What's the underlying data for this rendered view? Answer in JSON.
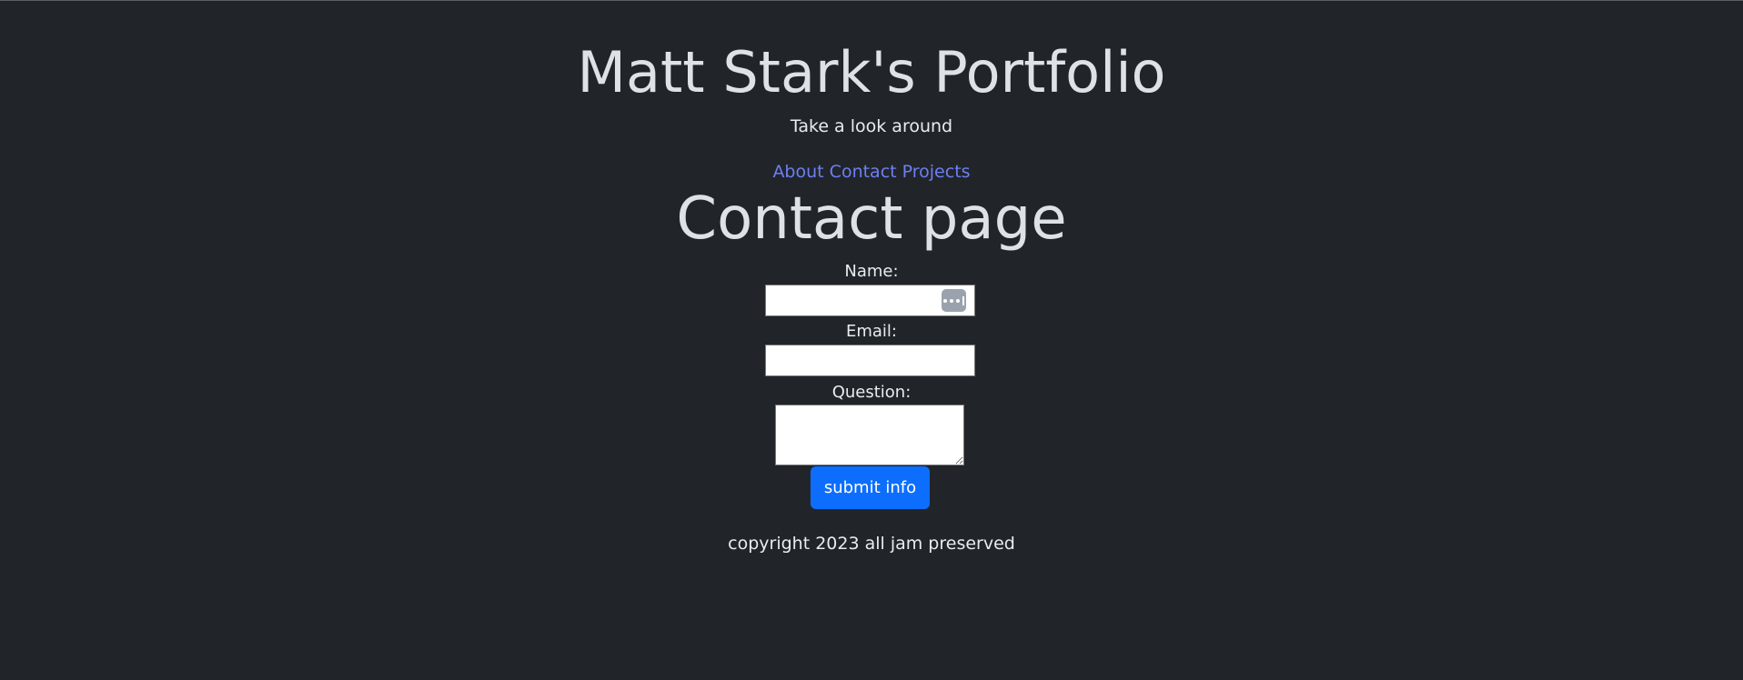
{
  "header": {
    "title": "Matt Stark's Portfolio",
    "tagline": "Take a look around"
  },
  "nav": {
    "items": [
      {
        "label": "About"
      },
      {
        "label": "Contact"
      },
      {
        "label": "Projects"
      }
    ]
  },
  "main": {
    "heading": "Contact page",
    "form": {
      "name_label": "Name:",
      "name_value": "",
      "email_label": "Email:",
      "email_value": "",
      "question_label": "Question:",
      "question_value": "",
      "submit_label": "submit info"
    }
  },
  "footer": {
    "text": "copyright 2023 all jam preserved"
  },
  "colors": {
    "background": "#212529",
    "link": "#6e7ff3",
    "button": "#0d6efd"
  }
}
